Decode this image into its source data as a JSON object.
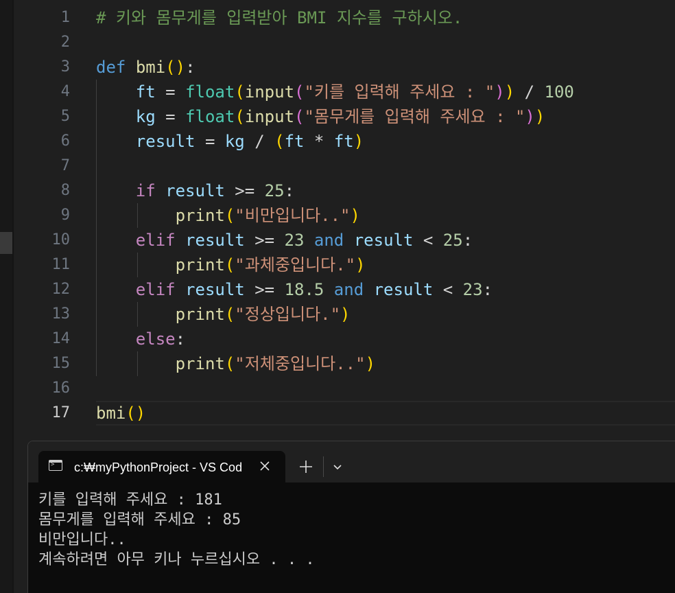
{
  "editor": {
    "active_line": 17,
    "lines": [
      {
        "number": "1",
        "tokens": [
          {
            "t": "# 키와 몸무게를 입력받아 BMI 지수를 구하시오.",
            "c": "comment"
          }
        ]
      },
      {
        "number": "2",
        "tokens": []
      },
      {
        "number": "3",
        "tokens": [
          {
            "t": "def",
            "c": "kw"
          },
          {
            "t": " ",
            "c": "op"
          },
          {
            "t": "bmi",
            "c": "fn"
          },
          {
            "t": "()",
            "c": "br1"
          },
          {
            "t": ":",
            "c": "op"
          }
        ]
      },
      {
        "number": "4",
        "tokens": [
          {
            "t": "    ",
            "c": "op"
          },
          {
            "t": "ft",
            "c": "var"
          },
          {
            "t": " = ",
            "c": "op"
          },
          {
            "t": "float",
            "c": "cls"
          },
          {
            "t": "(",
            "c": "br1"
          },
          {
            "t": "input",
            "c": "fn"
          },
          {
            "t": "(",
            "c": "br2"
          },
          {
            "t": "\"키를 입력해 주세요 : \"",
            "c": "str"
          },
          {
            "t": ")",
            "c": "br2"
          },
          {
            "t": ")",
            "c": "br1"
          },
          {
            "t": " / ",
            "c": "op"
          },
          {
            "t": "100",
            "c": "num"
          }
        ]
      },
      {
        "number": "5",
        "tokens": [
          {
            "t": "    ",
            "c": "op"
          },
          {
            "t": "kg",
            "c": "var"
          },
          {
            "t": " = ",
            "c": "op"
          },
          {
            "t": "float",
            "c": "cls"
          },
          {
            "t": "(",
            "c": "br1"
          },
          {
            "t": "input",
            "c": "fn"
          },
          {
            "t": "(",
            "c": "br2"
          },
          {
            "t": "\"몸무게를 입력해 주세요 : \"",
            "c": "str"
          },
          {
            "t": ")",
            "c": "br2"
          },
          {
            "t": ")",
            "c": "br1"
          }
        ]
      },
      {
        "number": "6",
        "tokens": [
          {
            "t": "    ",
            "c": "op"
          },
          {
            "t": "result",
            "c": "var"
          },
          {
            "t": " = ",
            "c": "op"
          },
          {
            "t": "kg",
            "c": "var"
          },
          {
            "t": " / ",
            "c": "op"
          },
          {
            "t": "(",
            "c": "br1"
          },
          {
            "t": "ft",
            "c": "var"
          },
          {
            "t": " * ",
            "c": "op"
          },
          {
            "t": "ft",
            "c": "var"
          },
          {
            "t": ")",
            "c": "br1"
          }
        ]
      },
      {
        "number": "7",
        "tokens": []
      },
      {
        "number": "8",
        "tokens": [
          {
            "t": "    ",
            "c": "op"
          },
          {
            "t": "if",
            "c": "ctrl"
          },
          {
            "t": " ",
            "c": "op"
          },
          {
            "t": "result",
            "c": "var"
          },
          {
            "t": " >= ",
            "c": "op"
          },
          {
            "t": "25",
            "c": "num"
          },
          {
            "t": ":",
            "c": "op"
          }
        ]
      },
      {
        "number": "9",
        "tokens": [
          {
            "t": "        ",
            "c": "op"
          },
          {
            "t": "print",
            "c": "fn"
          },
          {
            "t": "(",
            "c": "br1"
          },
          {
            "t": "\"비만입니다..\"",
            "c": "str"
          },
          {
            "t": ")",
            "c": "br1"
          }
        ]
      },
      {
        "number": "10",
        "tokens": [
          {
            "t": "    ",
            "c": "op"
          },
          {
            "t": "elif",
            "c": "ctrl"
          },
          {
            "t": " ",
            "c": "op"
          },
          {
            "t": "result",
            "c": "var"
          },
          {
            "t": " >= ",
            "c": "op"
          },
          {
            "t": "23",
            "c": "num"
          },
          {
            "t": " ",
            "c": "op"
          },
          {
            "t": "and",
            "c": "kw"
          },
          {
            "t": " ",
            "c": "op"
          },
          {
            "t": "result",
            "c": "var"
          },
          {
            "t": " < ",
            "c": "op"
          },
          {
            "t": "25",
            "c": "num"
          },
          {
            "t": ":",
            "c": "op"
          }
        ]
      },
      {
        "number": "11",
        "tokens": [
          {
            "t": "        ",
            "c": "op"
          },
          {
            "t": "print",
            "c": "fn"
          },
          {
            "t": "(",
            "c": "br1"
          },
          {
            "t": "\"과체중입니다.\"",
            "c": "str"
          },
          {
            "t": ")",
            "c": "br1"
          }
        ]
      },
      {
        "number": "12",
        "tokens": [
          {
            "t": "    ",
            "c": "op"
          },
          {
            "t": "elif",
            "c": "ctrl"
          },
          {
            "t": " ",
            "c": "op"
          },
          {
            "t": "result",
            "c": "var"
          },
          {
            "t": " >= ",
            "c": "op"
          },
          {
            "t": "18.5",
            "c": "num"
          },
          {
            "t": " ",
            "c": "op"
          },
          {
            "t": "and",
            "c": "kw"
          },
          {
            "t": " ",
            "c": "op"
          },
          {
            "t": "result",
            "c": "var"
          },
          {
            "t": " < ",
            "c": "op"
          },
          {
            "t": "23",
            "c": "num"
          },
          {
            "t": ":",
            "c": "op"
          }
        ]
      },
      {
        "number": "13",
        "tokens": [
          {
            "t": "        ",
            "c": "op"
          },
          {
            "t": "print",
            "c": "fn"
          },
          {
            "t": "(",
            "c": "br1"
          },
          {
            "t": "\"정상입니다.\"",
            "c": "str"
          },
          {
            "t": ")",
            "c": "br1"
          }
        ]
      },
      {
        "number": "14",
        "tokens": [
          {
            "t": "    ",
            "c": "op"
          },
          {
            "t": "else",
            "c": "ctrl"
          },
          {
            "t": ":",
            "c": "op"
          }
        ]
      },
      {
        "number": "15",
        "tokens": [
          {
            "t": "        ",
            "c": "op"
          },
          {
            "t": "print",
            "c": "fn"
          },
          {
            "t": "(",
            "c": "br1"
          },
          {
            "t": "\"저체중입니다..\"",
            "c": "str"
          },
          {
            "t": ")",
            "c": "br1"
          }
        ]
      },
      {
        "number": "16",
        "tokens": []
      },
      {
        "number": "17",
        "tokens": [
          {
            "t": "bmi",
            "c": "fn"
          },
          {
            "t": "()",
            "c": "br1"
          }
        ]
      }
    ]
  },
  "terminal": {
    "tab_title": "c:₩myPythonProject - VS Cod",
    "icons": {
      "tab_icon": "terminal-icon",
      "close": "close-icon",
      "new_tab": "plus-icon",
      "dropdown": "chevron-down-icon"
    },
    "output": [
      "키를 입력해 주세요 : 181",
      "몸무게를 입력해 주세요 : 85",
      "비만입니다..",
      "계속하려면 아무 키나 누르십시오 . . ."
    ]
  }
}
